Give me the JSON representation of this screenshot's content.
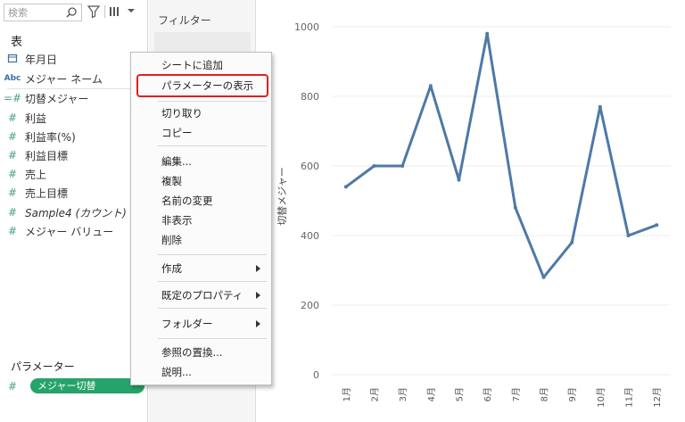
{
  "sidebar": {
    "search_placeholder": "検索",
    "tables_title": "表",
    "fields": [
      {
        "icon": "calendar",
        "label": "年月日"
      },
      {
        "icon": "abc",
        "label": "メジャー ネーム"
      },
      {
        "icon": "calc-measure",
        "label": "切替メジャー"
      },
      {
        "icon": "measure",
        "label": "利益"
      },
      {
        "icon": "measure",
        "label": "利益率(%)"
      },
      {
        "icon": "measure",
        "label": "利益目標"
      },
      {
        "icon": "measure",
        "label": "売上"
      },
      {
        "icon": "measure",
        "label": "売上目標"
      },
      {
        "icon": "measure",
        "label": "Sample4 (カウント)"
      },
      {
        "icon": "measure",
        "label": "メジャー バリュー"
      }
    ],
    "parameters_title": "パラメーター",
    "parameter_pill": "メジャー切替"
  },
  "shelf": {
    "filters_title": "フィルター"
  },
  "context_menu": {
    "items": [
      {
        "label": "シートに追加"
      },
      {
        "label": "パラメーターの表示"
      },
      {
        "label": "切り取り"
      },
      {
        "label": "コピー"
      },
      {
        "label": "編集..."
      },
      {
        "label": "複製"
      },
      {
        "label": "名前の変更"
      },
      {
        "label": "非表示"
      },
      {
        "label": "削除"
      },
      {
        "label": "作成"
      },
      {
        "label": "既定のプロパティ"
      },
      {
        "label": "フォルダー"
      },
      {
        "label": "参照の置換..."
      },
      {
        "label": "説明..."
      }
    ]
  },
  "chart_data": {
    "type": "line",
    "categories": [
      "1月",
      "2月",
      "3月",
      "4月",
      "5月",
      "6月",
      "7月",
      "8月",
      "9月",
      "10月",
      "11月",
      "12月"
    ],
    "values": [
      540,
      600,
      600,
      830,
      560,
      980,
      480,
      280,
      380,
      770,
      400,
      430
    ],
    "ylabel": "切替メジャー",
    "xlabel": "",
    "ylim": [
      0,
      1000
    ],
    "yticks": [
      0,
      200,
      400,
      600,
      800,
      1000
    ],
    "grid": true,
    "line_color": "#4e79a7"
  }
}
